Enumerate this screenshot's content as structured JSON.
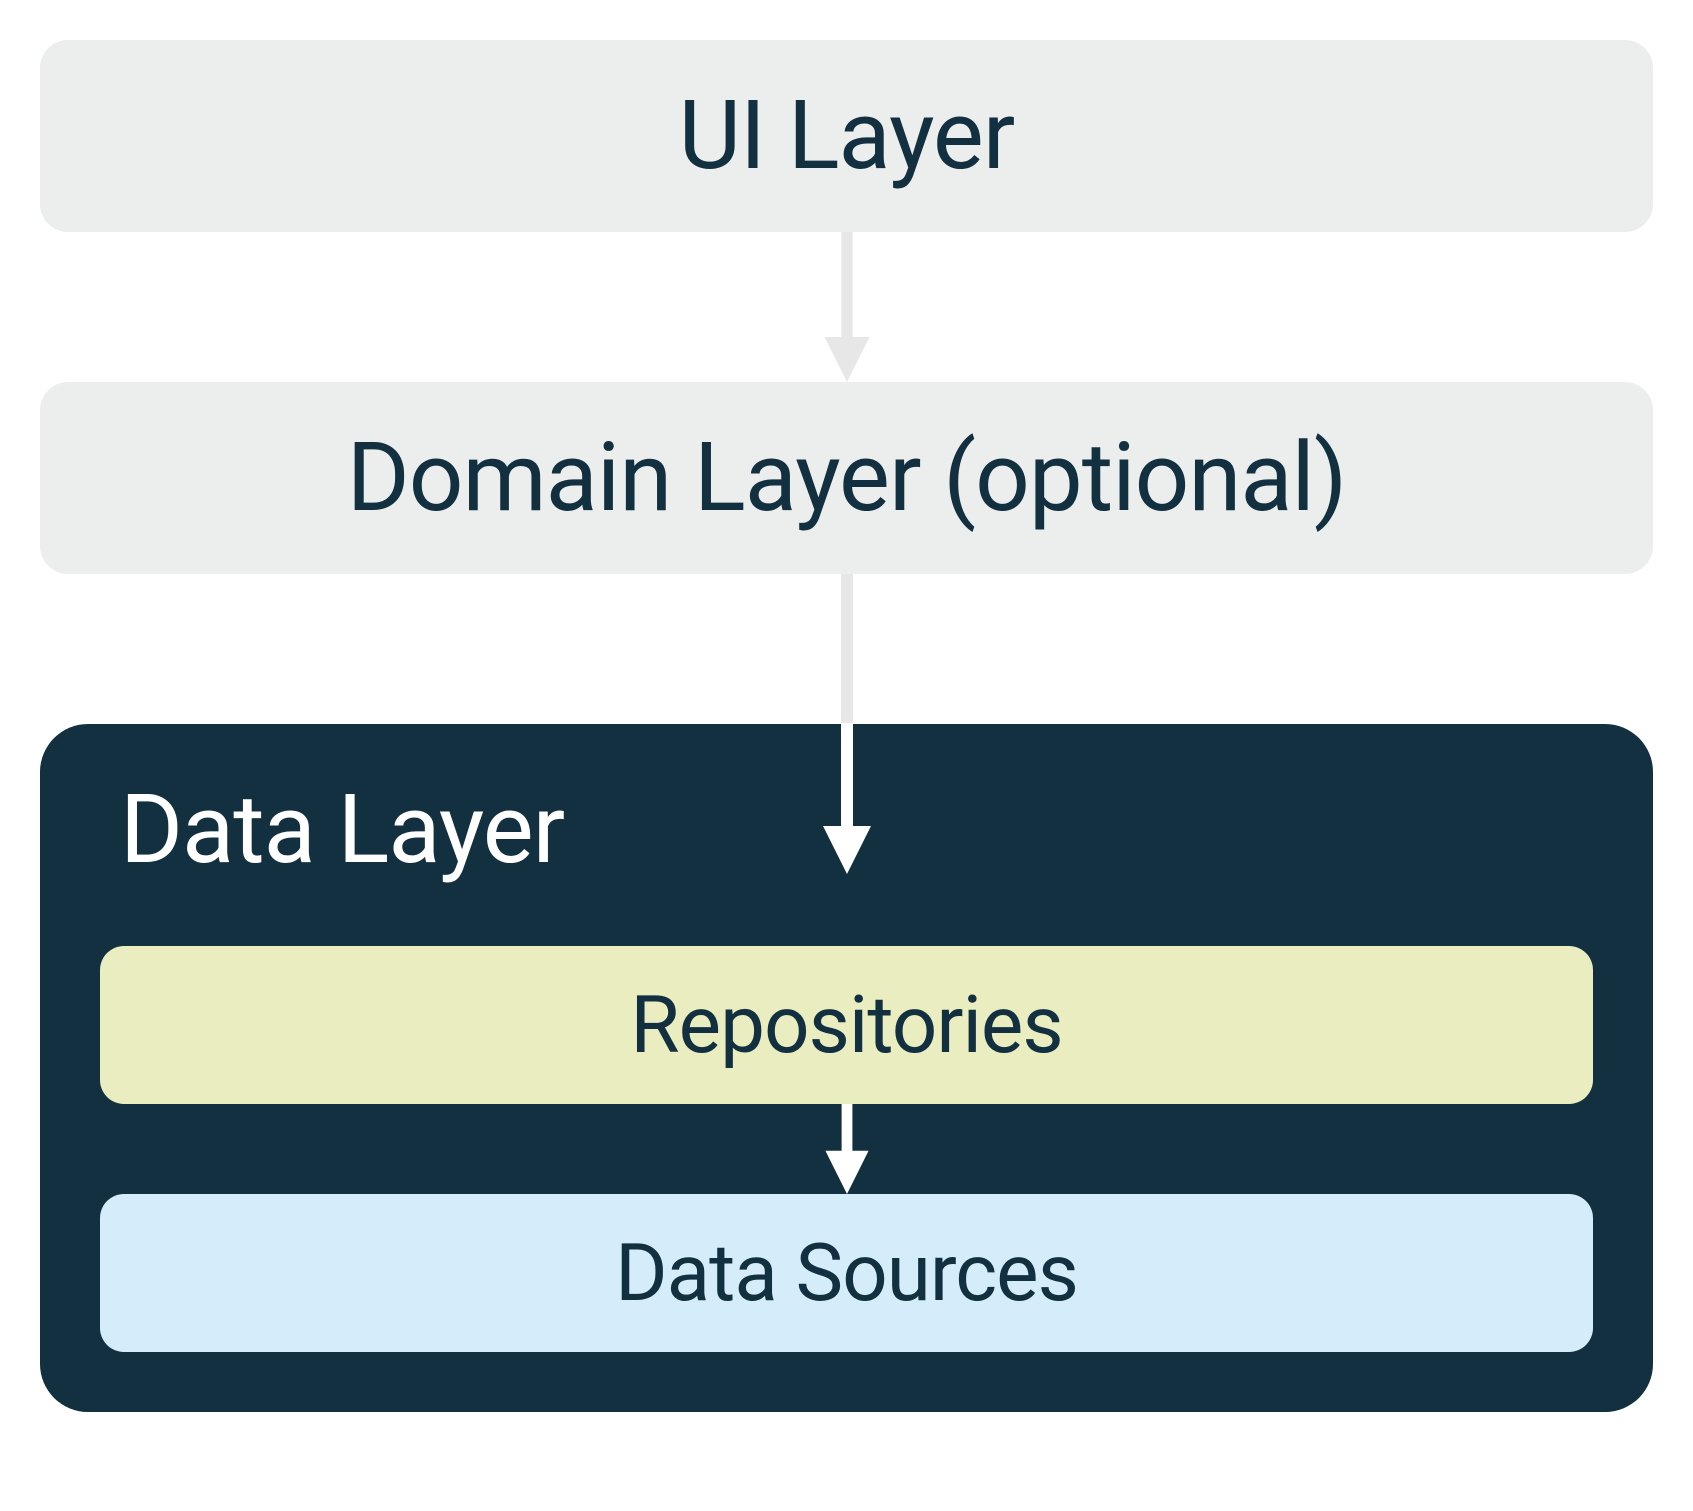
{
  "diagram": {
    "layers": {
      "ui": {
        "label": "UI Layer"
      },
      "domain": {
        "label": "Domain Layer (optional)"
      },
      "data": {
        "title": "Data Layer",
        "inner": {
          "repositories": {
            "label": "Repositories"
          },
          "dataSources": {
            "label": "Data Sources"
          }
        }
      }
    },
    "colors": {
      "lightBox": "#eceded",
      "darkBox": "#12303f",
      "repositories": "#e9edc0",
      "dataSources": "#d5ecfb",
      "arrowLight": "#e7e7e7",
      "arrowWhite": "#ffffff",
      "textDark": "#12303f",
      "textLight": "#ffffff"
    }
  }
}
